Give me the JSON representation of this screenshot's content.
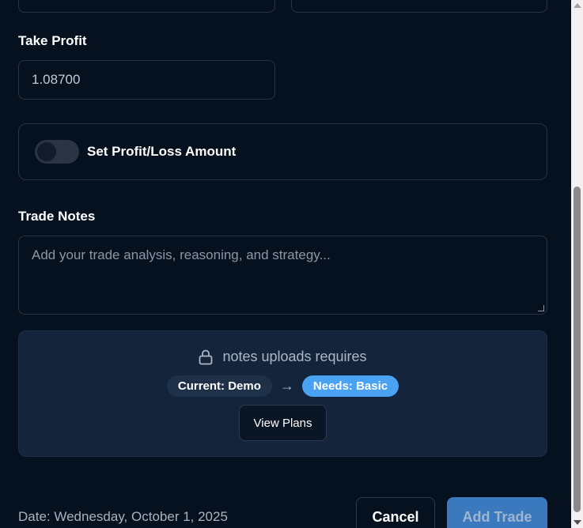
{
  "form": {
    "take_profit_label": "Take Profit",
    "take_profit_value": "1.08700",
    "set_profit_loss_label": "Set Profit/Loss Amount",
    "set_profit_loss_enabled": false,
    "trade_notes_label": "Trade Notes",
    "trade_notes_placeholder": "Add your trade analysis, reasoning, and strategy..."
  },
  "upsell": {
    "message": "notes uploads requires",
    "current_plan": "Current: Demo",
    "arrow": "→",
    "needed_plan": "Needs: Basic",
    "view_plans_label": "View Plans"
  },
  "footer": {
    "date_text": "Date: Wednesday, October 1, 2025",
    "cancel_label": "Cancel",
    "add_trade_label": "Add Trade"
  },
  "icons": {
    "lock": "lock-icon"
  },
  "colors": {
    "background": "#06111f",
    "accent": "#4aa3f2",
    "add_button": "#3a79bd"
  }
}
